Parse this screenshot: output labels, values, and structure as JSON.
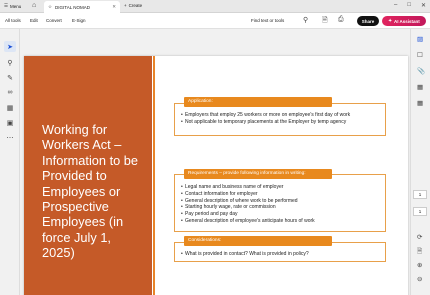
{
  "tabs": {
    "menu_label": "Menu",
    "active_tab": "DIGITAL NOMAD",
    "create_label": "Create"
  },
  "toolbar": {
    "all_tools": "All tools",
    "edit": "Edit",
    "convert": "Convert",
    "esign": "E-Sign",
    "find_placeholder": "Find text or tools",
    "share": "Share",
    "ai_assistant": "AI Assistant"
  },
  "page_indicators": {
    "top": "1",
    "bottom": "1"
  },
  "slide": {
    "title": "Working for Workers Act – Information to be Provided to Employees or Prospective Employees (in force July 1, 2025)",
    "sections": [
      {
        "header": "Application:",
        "items": [
          "Employers that employ 25 workers or more on employee's first day of work",
          "Not applicable to temporary placements at the Employer by temp agency"
        ]
      },
      {
        "header": "Requirements – provide following information in writing:",
        "items": [
          "Legal name and business name of employer",
          "Contact information for employer",
          "General description of where work to be performed",
          "Starting hourly wage, rate or commission",
          "Pay period and pay day",
          "General description of employee's anticipate hours of work"
        ]
      },
      {
        "header": "Considerations:",
        "items": [
          "What is provided in contact? What is provided in policy?"
        ]
      }
    ]
  },
  "colors": {
    "panel": "#c55a28",
    "header": "#e8891e",
    "ai_button": "#e0245e"
  }
}
